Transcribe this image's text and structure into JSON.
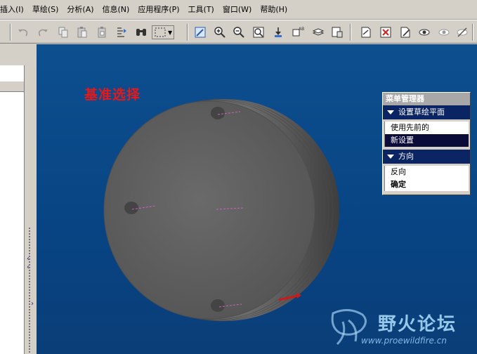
{
  "menubar": {
    "items": [
      {
        "label": "插入(I)",
        "id": "insert"
      },
      {
        "label": "草绘(S)",
        "id": "sketch"
      },
      {
        "label": "分析(A)",
        "id": "analysis"
      },
      {
        "label": "信息(N)",
        "id": "info"
      },
      {
        "label": "应用程序(P)",
        "id": "applications"
      },
      {
        "label": "工具(T)",
        "id": "tools"
      },
      {
        "label": "窗口(W)",
        "id": "window"
      },
      {
        "label": "帮助(H)",
        "id": "help"
      }
    ]
  },
  "viewport": {
    "title": "基准选择",
    "title_color": "#e81818",
    "background": "#084483"
  },
  "menu_manager": {
    "title": "菜单管理器",
    "sections": [
      {
        "header": "设置草绘平面",
        "options": [
          {
            "label": "使用先前的",
            "selected": false
          },
          {
            "label": "新设置",
            "selected": true
          }
        ]
      },
      {
        "header": "方向",
        "options": [
          {
            "label": "反向",
            "selected": false
          },
          {
            "label": "确定",
            "selected": false
          }
        ]
      }
    ]
  },
  "watermark": {
    "name": "野火论坛",
    "url": "www.proewildfire.cn"
  },
  "toolbar": {
    "icons": [
      "undo-icon",
      "redo-icon",
      "copy-icon",
      "paste-icon",
      "paste-special-icon",
      "regenerate-icon",
      "find-icon",
      "selection-box-icon",
      "repaint-icon",
      "zoom-in-icon",
      "zoom-out-icon",
      "refit-icon",
      "orient-icon",
      "named-views-icon",
      "layers-icon",
      "view-manager-icon",
      "datum-icon",
      "close-window-icon",
      "appearance-icon",
      "display-icon",
      "hidden-line-icon",
      "no-hidden-icon"
    ]
  }
}
